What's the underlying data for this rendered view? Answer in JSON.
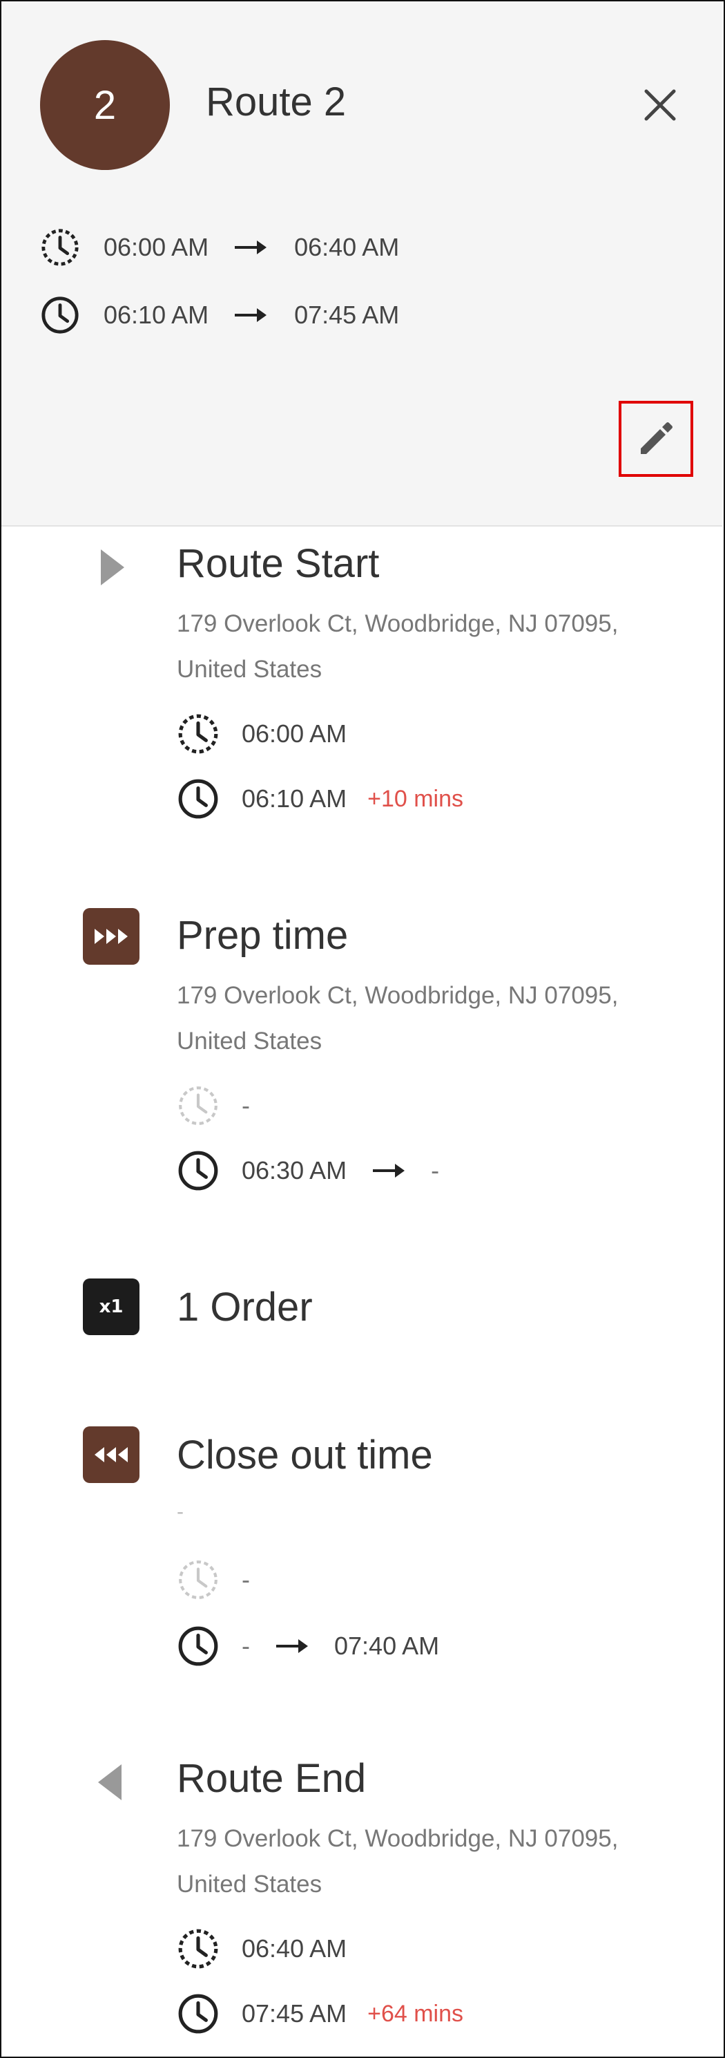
{
  "header": {
    "avatar_number": "2",
    "title": "Route 2",
    "planned_time": {
      "start": "06:00 AM",
      "end": "06:40 AM"
    },
    "actual_time": {
      "start": "06:10 AM",
      "end": "07:45 AM"
    },
    "icons": {
      "close": "close-icon",
      "edit": "pencil-icon",
      "planned": "clock-dashed-icon",
      "actual": "clock-icon"
    }
  },
  "colors": {
    "brand": "#633a2c",
    "delay": "#e0504a",
    "highlight": "#e00000",
    "order_badge": "#1c1c1c"
  },
  "stops": {
    "route_start": {
      "title": "Route Start",
      "address_line1": "179 Overlook Ct, Woodbridge, NJ 07095,",
      "address_line2": "United States",
      "planned": "06:00 AM",
      "actual": "06:10 AM",
      "delay": "+10 mins"
    },
    "prep_time": {
      "title": "Prep time",
      "address_line1": "179 Overlook Ct, Woodbridge, NJ 07095,",
      "address_line2": "United States",
      "planned": "-",
      "actual_start": "06:30 AM",
      "actual_end": "-"
    },
    "order": {
      "badge": "x1",
      "title": "1 Order"
    },
    "close_out": {
      "title": "Close out time",
      "address": "-",
      "planned": "-",
      "actual_start": "-",
      "actual_end": "07:40 AM"
    },
    "route_end": {
      "title": "Route End",
      "address_line1": "179 Overlook Ct, Woodbridge, NJ 07095,",
      "address_line2": "United States",
      "planned": "06:40 AM",
      "actual": "07:45 AM",
      "delay": "+64 mins"
    }
  }
}
